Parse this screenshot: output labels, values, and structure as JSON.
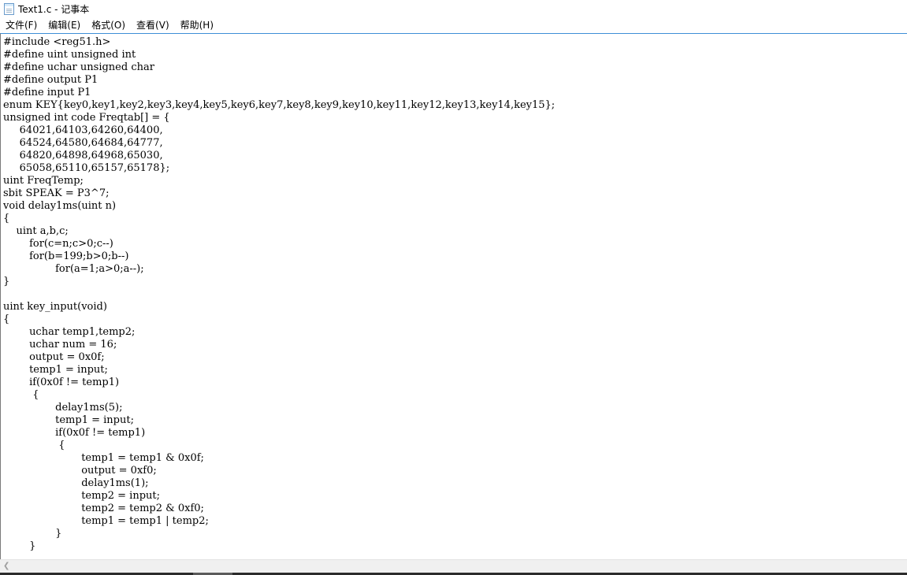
{
  "window": {
    "title": "Text1.c - 记事本",
    "app_icon": "notepad-icon"
  },
  "menu": {
    "items": [
      {
        "label": "文件(F)"
      },
      {
        "label": "编辑(E)"
      },
      {
        "label": "格式(O)"
      },
      {
        "label": "查看(V)"
      },
      {
        "label": "帮助(H)"
      }
    ]
  },
  "editor": {
    "content": "#include <reg51.h>\n#define uint unsigned int\n#define uchar unsigned char\n#define output P1\n#define input P1\nenum KEY{key0,key1,key2,key3,key4,key5,key6,key7,key8,key9,key10,key11,key12,key13,key14,key15};\nunsigned int code Freqtab[] = {\n     64021,64103,64260,64400,\n     64524,64580,64684,64777,\n     64820,64898,64968,65030,\n     65058,65110,65157,65178};\nuint FreqTemp;\nsbit SPEAK = P3^7;\nvoid delay1ms(uint n)\n{\n    uint a,b,c;\n\tfor(c=n;c>0;c--)\n\tfor(b=199;b>0;b--)\n\t\tfor(a=1;a>0;a--);\n}\n\nuint key_input(void)\n{\n\tuchar temp1,temp2;\n\tuchar num = 16;\n\toutput = 0x0f;\n\ttemp1 = input;\n\tif(0x0f != temp1)\n\t {\n\t\tdelay1ms(5);\n\t\ttemp1 = input;\n\t\tif(0x0f != temp1)\n\t\t {\n\t\t\ttemp1 = temp1 & 0x0f;\n\t\t\toutput = 0xf0;\n\t\t\tdelay1ms(1);\n\t\t\ttemp2 = input;\n\t\t\ttemp2 = temp2 & 0xf0;\n\t\t\ttemp1 = temp1 | temp2;\n\t\t}\n\t}"
  },
  "scrollbar": {
    "left_arrow": "chevron-left-icon"
  }
}
